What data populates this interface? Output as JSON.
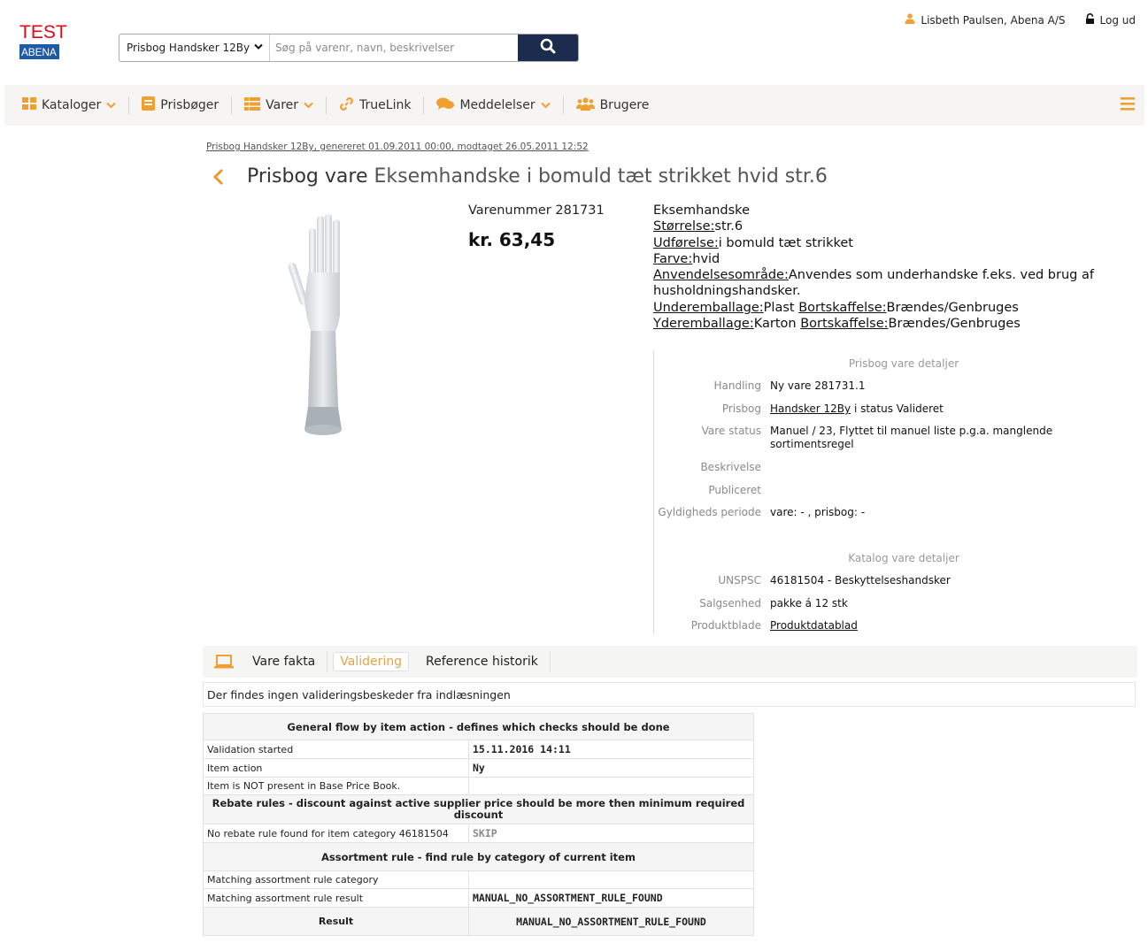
{
  "header": {
    "logo_test": "TEST",
    "logo_brand": "ABENA",
    "search_scope": "Prisbog Handsker 12By",
    "search_placeholder": "Søg på varenr, navn, beskrivelser",
    "user": "Lisbeth Paulsen, Abena A/S",
    "logout": "Log ud"
  },
  "nav": {
    "items": [
      {
        "label": "Kataloger",
        "icon": "grid-icon",
        "dropdown": true
      },
      {
        "label": "Prisbøger",
        "icon": "book-icon",
        "dropdown": false
      },
      {
        "label": "Varer",
        "icon": "list-icon",
        "dropdown": true
      },
      {
        "label": "TrueLink",
        "icon": "link-icon",
        "dropdown": false
      },
      {
        "label": "Meddelelser",
        "icon": "chat-icon",
        "dropdown": true
      },
      {
        "label": "Brugere",
        "icon": "users-icon",
        "dropdown": false
      }
    ]
  },
  "breadcrumb": "Prisbog Handsker 12By, genereret 01.09.2011 00:00, modtaget 26.05.2011 12:52",
  "title": {
    "prefix": "Prisbog vare",
    "name": "Eksemhandske i bomuld tæt strikket hvid str.6"
  },
  "product": {
    "varenummer": "Varenummer 281731",
    "price": "kr. 63,45",
    "desc_title": "Eksemhandske",
    "stoerrelse_label": "Størrelse:",
    "stoerrelse": "str.6",
    "udfoerelse_label": "Udførelse:",
    "udfoerelse": "i bomuld tæt strikket",
    "farve_label": "Farve:",
    "farve": "hvid",
    "anvendelse_label": "Anvendelsesområde:",
    "anvendelse": "Anvendes som underhandske f.eks. ved brug af husholdningshandsker.",
    "underemb_label": "Underemballage:",
    "underemb": "Plast",
    "bortsk_label": "Bortskaffelse:",
    "bortsk1": "Brændes/Genbruges",
    "yderemb_label": "Yderemballage:",
    "yderemb": "Karton",
    "bortsk2": "Brændes/Genbruges"
  },
  "details": {
    "heading1": "Prisbog vare detaljer",
    "handling_label": "Handling",
    "handling": "Ny vare 281731.1",
    "prisbog_label": "Prisbog",
    "prisbog_link": "Handsker 12By",
    "prisbog_status": "i status Valideret",
    "vare_status_label": "Vare status",
    "vare_status": "Manuel / 23, Flyttet til manuel liste p.g.a. manglende sortimentsregel",
    "beskrivelse_label": "Beskrivelse",
    "publiceret_label": "Publiceret",
    "gyldighed_label": "Gyldigheds periode",
    "gyldighed": "vare: - , prisbog: -",
    "heading2": "Katalog vare detaljer",
    "unspsc_label": "UNSPSC",
    "unspsc": "46181504 - Beskyttelseshandsker",
    "salgsenhed_label": "Salgsenhed",
    "salgsenhed": "pakke á 12 stk",
    "produktblade_label": "Produktblade",
    "produktblade": "Produktdatablad"
  },
  "tabs": {
    "t1": "Vare fakta",
    "t2": "Validering",
    "t3": "Reference historik"
  },
  "message": "Der findes ingen valideringsbeskeder fra indlæsningen",
  "validation": {
    "sec1": "General flow by item action - defines which checks should be done",
    "started_label": "Validation started",
    "started": "15.11.2016 14:11",
    "action_label": "Item action",
    "action": "Ny",
    "notpresent": "Item is NOT present in Base Price Book.",
    "sec2": "Rebate rules - discount against active supplier price should be more then minimum required discount",
    "norebate_label": "No rebate rule found for item category 46181504",
    "norebate": "SKIP",
    "sec3": "Assortment rule - find rule by category of current item",
    "cat_label": "Matching assortment rule category",
    "cat": "",
    "res_label": "Matching assortment rule result",
    "res": "MANUAL_NO_ASSORTMENT_RULE_FOUND",
    "final_label": "Result",
    "final": "MANUAL_NO_ASSORTMENT_RULE_FOUND"
  },
  "colors": {
    "accent": "#e89a2b",
    "search_button": "#1b2c4f",
    "logo_red": "#e2061b",
    "logo_blue": "#1f5aa6"
  }
}
